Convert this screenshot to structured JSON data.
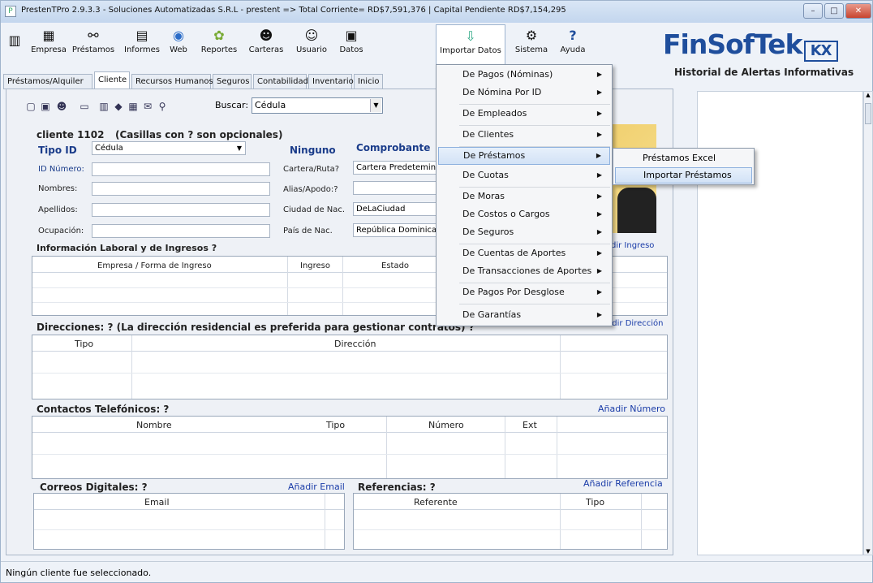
{
  "window": {
    "title": "PrestenTPro 2.9.3.3 - Soluciones Automatizadas S.R.L - prestent => Total Corriente= RD$7,591,376 | Capital Pendiente RD$7,154,295"
  },
  "toolbar": {
    "buttons": [
      "Empresa",
      "Préstamos",
      "Informes",
      "Web",
      "Reportes",
      "Carteras",
      "Usuario",
      "Datos",
      "Importar Datos",
      "Sistema",
      "Ayuda"
    ]
  },
  "brand": {
    "logo": "FinSofTek",
    "logo_mark": "KX",
    "panel_title": "Historial de Alertas Informativas"
  },
  "tabs": [
    "Préstamos/Alquiler",
    "Cliente",
    "Recursos Humanos",
    "Seguros",
    "Contabilidad",
    "Inventario",
    "Inicio"
  ],
  "search": {
    "label": "Buscar:",
    "value": "Cédula"
  },
  "client": {
    "header": "cliente 1102",
    "optional_note": "(Casillas con ? son opcionales)",
    "tipo_id_label": "Tipo ID",
    "tipo_id_value": "Cédula",
    "ninguno": "Ninguno",
    "comprobante": "Comprobante",
    "id_numero": "ID Número:",
    "nombres": "Nombres:",
    "apellidos": "Apellidos:",
    "ocupacion": "Ocupación:",
    "cartera_label": "Cartera/Ruta?",
    "cartera_value": "Cartera Predetemina",
    "alias_label": "Alias/Apodo:?",
    "ciudad_label": "Ciudad de Nac.",
    "ciudad_value": "DeLaCiudad",
    "pais_label": "País de Nac.",
    "pais_value": "República Dominican"
  },
  "laboral": {
    "title": "Información Laboral y de Ingresos ?",
    "link": "dir Ingreso",
    "headers": [
      "Empresa / Forma de Ingreso",
      "Ingreso",
      "Estado"
    ]
  },
  "direcciones": {
    "title": "Direcciones: ?  (La dirección residencial es preferida para gestionar contratos) ?",
    "link": "Añadir Dirección",
    "headers": [
      "Tipo",
      "Dirección"
    ]
  },
  "telefonos": {
    "title": "Contactos Telefónicos: ?",
    "link": "Añadir Número",
    "headers": [
      "Nombre",
      "Tipo",
      "Número",
      "Ext"
    ]
  },
  "correos": {
    "title": "Correos Digitales: ?",
    "link": "Añadir Email",
    "headers": [
      "Email"
    ]
  },
  "referencias": {
    "title": "Referencias: ?",
    "link": "Añadir Referencia",
    "headers": [
      "Referente",
      "Tipo"
    ]
  },
  "menu": {
    "items": [
      "De Pagos (Nóminas)",
      "De Nómina Por ID",
      "De Empleados",
      "De Clientes",
      "De Préstamos",
      "De Cuotas",
      "De Moras",
      "De Costos o Cargos",
      "De Seguros",
      "De Cuentas de Aportes",
      "De Transacciones de Aportes",
      "De Pagos Por Desglose",
      "De Garantías"
    ],
    "submenu": [
      "Préstamos Excel",
      "Importar Préstamos"
    ]
  },
  "status": {
    "text": "Ningún cliente fue seleccionado."
  }
}
